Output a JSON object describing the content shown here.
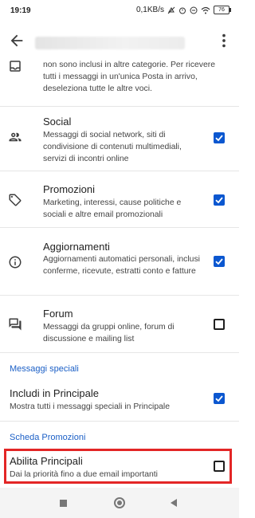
{
  "status_bar": {
    "time": "19:19",
    "network_speed": "0,1KB/s",
    "battery": "76"
  },
  "partial_item": {
    "desc": "non sono inclusi in altre categorie. Per ricevere tutti i messaggi in un'unica Posta in arrivo, deseleziona tutte le altre voci.",
    "icon": "inbox-icon"
  },
  "categories": [
    {
      "title": "Social",
      "desc": "Messaggi di social network, siti di condivisione di contenuti multimediali, servizi di incontri online",
      "checked": true,
      "icon": "people-icon"
    },
    {
      "title": "Promozioni",
      "desc": "Marketing, interessi, cause politiche e sociali e altre email promozionali",
      "checked": true,
      "icon": "tag-icon"
    },
    {
      "title": "Aggiornamenti",
      "desc": "Aggiornamenti automatici personali, inclusi conferme, ricevute, estratti conto e fatture",
      "checked": true,
      "icon": "info-icon"
    },
    {
      "title": "Forum",
      "desc": "Messaggi da gruppi online, forum di discussione e mailing list",
      "checked": false,
      "icon": "forum-icon"
    }
  ],
  "special_section": {
    "header": "Messaggi speciali",
    "item": {
      "title": "Includi in Principale",
      "desc": "Mostra tutti i messaggi speciali in Principale",
      "checked": true
    }
  },
  "promo_section": {
    "header": "Scheda Promozioni",
    "item": {
      "title": "Abilita Principali",
      "desc": "Dai la priorità fino a due email importanti",
      "checked": false
    }
  },
  "colors": {
    "accent": "#0b57d0",
    "section_header": "#1b5fc6",
    "highlight": "#e32626"
  }
}
